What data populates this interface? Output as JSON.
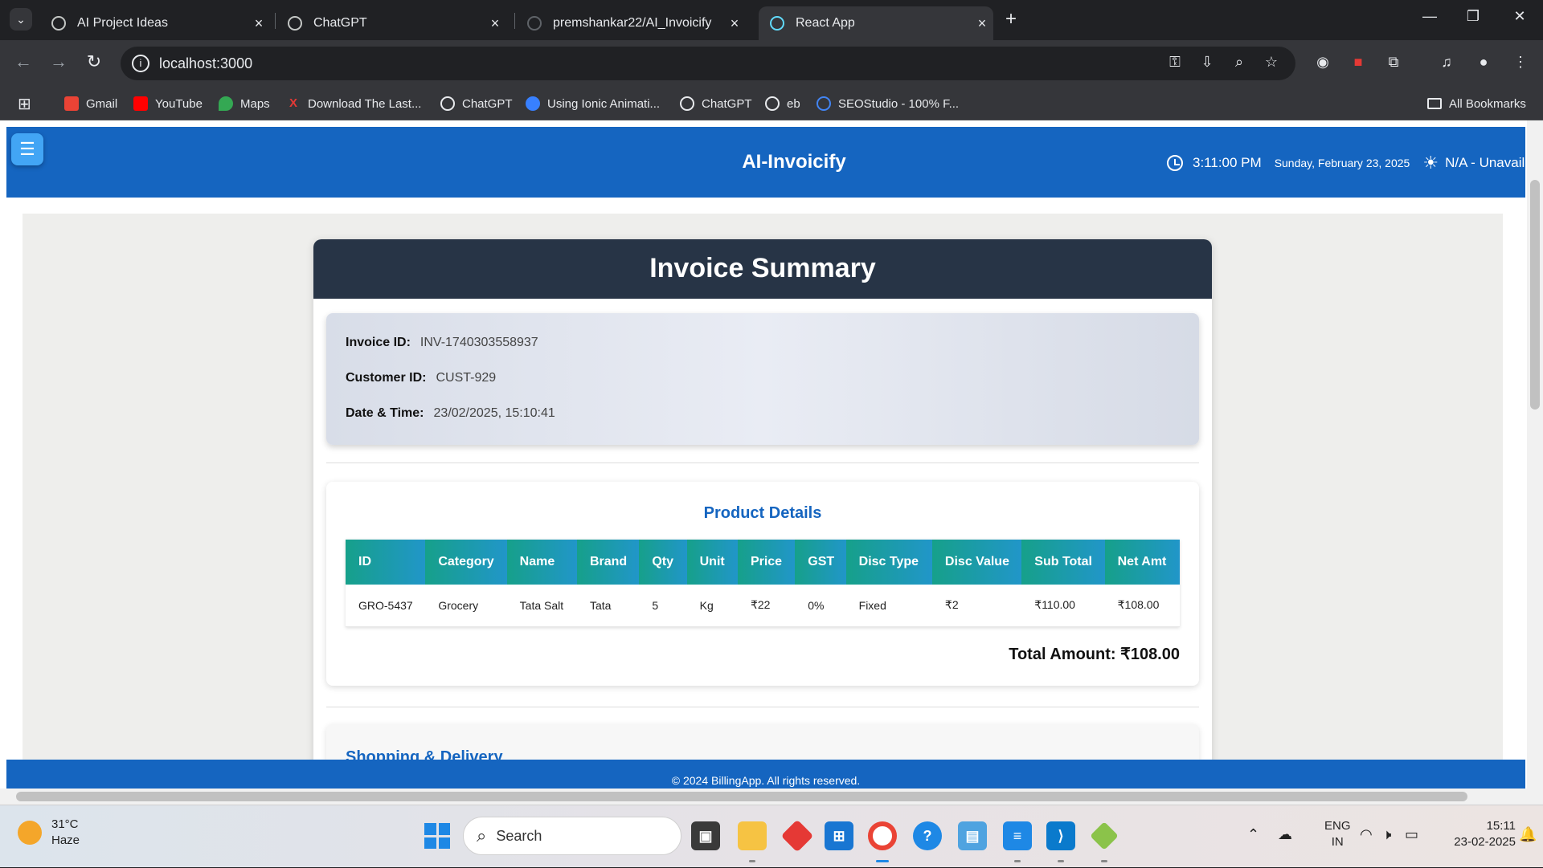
{
  "browser": {
    "tabs": [
      {
        "title": "AI Project Ideas",
        "active": false
      },
      {
        "title": "ChatGPT",
        "active": false
      },
      {
        "title": "premshankar22/AI_Invoicify",
        "active": false
      },
      {
        "title": "React App",
        "active": true
      }
    ],
    "address": "localhost:3000",
    "bookmarks": [
      {
        "label": "Gmail",
        "icon": "gmail-icon",
        "color": "#ea4335"
      },
      {
        "label": "YouTube",
        "icon": "youtube-icon",
        "color": "#ff0000"
      },
      {
        "label": "Maps",
        "icon": "maps-icon",
        "color": "#34a853"
      },
      {
        "label": "Download The Last...",
        "icon": "download-x-icon",
        "color": "#e53935"
      },
      {
        "label": "ChatGPT",
        "icon": "chatgpt-icon",
        "color": "#e8eaed"
      },
      {
        "label": "Using Ionic Animati...",
        "icon": "ionic-icon",
        "color": "#3880ff"
      },
      {
        "label": "ChatGPT",
        "icon": "chatgpt-icon",
        "color": "#e8eaed"
      },
      {
        "label": "eb",
        "icon": "chatgpt-icon",
        "color": "#e8eaed"
      },
      {
        "label": "SEOStudio - 100% F...",
        "icon": "seostudio-icon",
        "color": "#4285f4"
      }
    ],
    "all_bookmarks": "All Bookmarks"
  },
  "app": {
    "title": "AI-Invoicify",
    "time": "3:11:00 PM",
    "date": "Sunday, February 23, 2025",
    "weather": "N/A - Unavaila",
    "footer": "© 2024 BillingApp. All rights reserved."
  },
  "invoice": {
    "heading": "Invoice Summary",
    "id_label": "Invoice ID:",
    "id_value": "INV-1740303558937",
    "customer_label": "Customer ID:",
    "customer_value": "CUST-929",
    "datetime_label": "Date & Time:",
    "datetime_value": "23/02/2025, 15:10:41"
  },
  "products": {
    "title": "Product Details",
    "columns": [
      "ID",
      "Category",
      "Name",
      "Brand",
      "Qty",
      "Unit",
      "Price",
      "GST",
      "Disc Type",
      "Disc Value",
      "Sub Total",
      "Net Amt"
    ],
    "rows": [
      [
        "GRO-5437",
        "Grocery",
        "Tata Salt",
        "Tata",
        "5",
        "Kg",
        "₹22",
        "0%",
        "Fixed",
        "₹2",
        "₹110.00",
        "₹108.00"
      ]
    ],
    "total": "Total Amount: ₹108.00"
  },
  "shipping": {
    "title": "Shopping & Delivery"
  },
  "taskbar": {
    "weather_temp": "31°C",
    "weather_desc": "Haze",
    "search": "Search",
    "lang_1": "ENG",
    "lang_2": "IN",
    "time": "15:11",
    "date": "23-02-2025"
  }
}
